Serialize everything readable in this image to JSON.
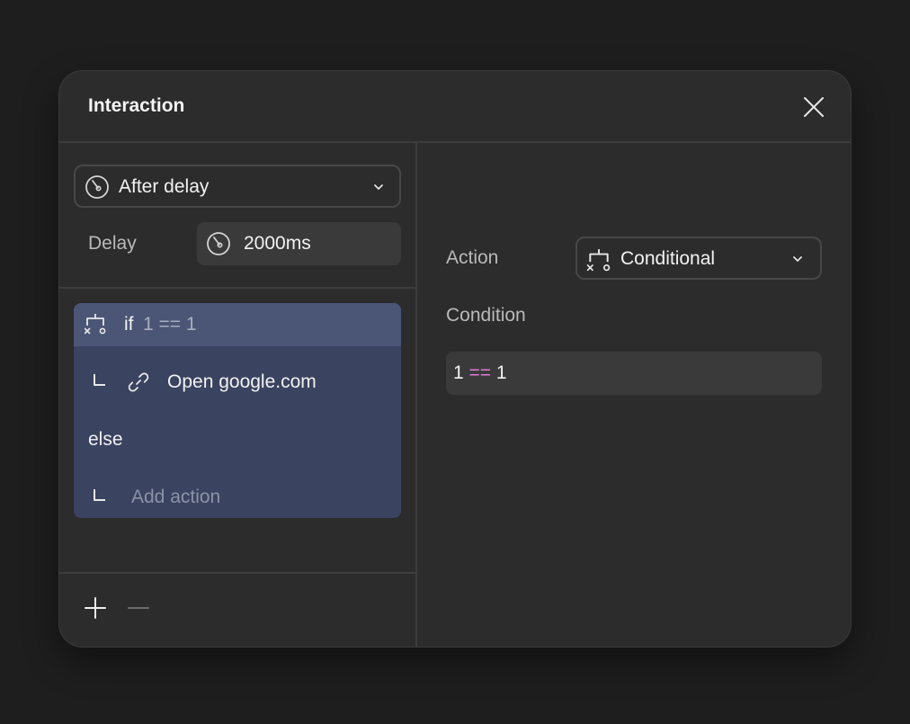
{
  "dialog": {
    "title": "Interaction",
    "close_icon": "close-icon"
  },
  "trigger": {
    "icon": "timer-icon",
    "label": "After delay",
    "chevron_icon": "chevron-down-icon"
  },
  "delay": {
    "label": "Delay",
    "icon": "timer-icon",
    "value": "2000ms"
  },
  "tree": {
    "if_row": {
      "icon": "conditional-icon",
      "keyword": "if",
      "condition": "1 == 1",
      "selected": true
    },
    "then_action": {
      "icon": "link-icon",
      "label": "Open google.com"
    },
    "else_label": "else",
    "else_action": {
      "label": "Add action"
    }
  },
  "footer": {
    "add_icon": "plus-icon",
    "remove_icon": "minus-icon"
  },
  "detail": {
    "action_label": "Action",
    "action_value": "Conditional",
    "action_icon": "conditional-icon",
    "condition_label": "Condition",
    "condition": {
      "left": "1",
      "operator": "==",
      "right": "1"
    }
  },
  "colors": {
    "background": "#1e1e1e",
    "panel": "#2c2c2c",
    "tree_bg": "#3a4360",
    "tree_selected": "#4b5676",
    "operator": "#e27bd6"
  }
}
